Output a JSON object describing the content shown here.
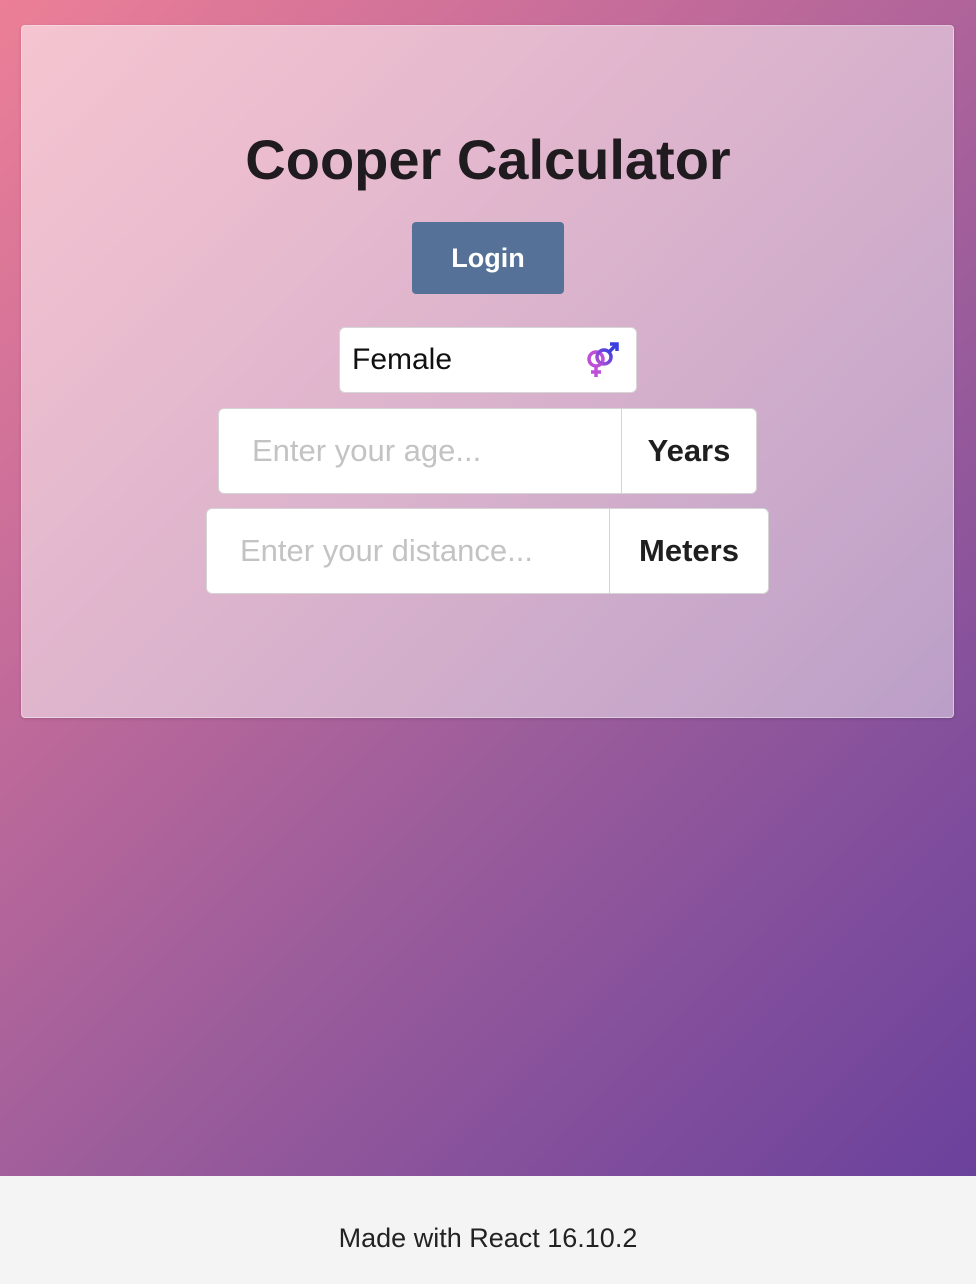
{
  "app": {
    "title": "Cooper Calculator"
  },
  "auth": {
    "login_label": "Login"
  },
  "gender_select": {
    "selected": "Female",
    "icon": "gender-icon"
  },
  "age_field": {
    "placeholder": "Enter your age...",
    "value": "",
    "unit": "Years"
  },
  "distance_field": {
    "placeholder": "Enter your distance...",
    "value": "",
    "unit": "Meters"
  },
  "footer": {
    "text": "Made with React 16.10.2"
  },
  "colors": {
    "login_button": "#567197",
    "gradient_start": "#ec7f97",
    "gradient_end": "#6a419c",
    "footer_bg": "#f4f4f4"
  }
}
